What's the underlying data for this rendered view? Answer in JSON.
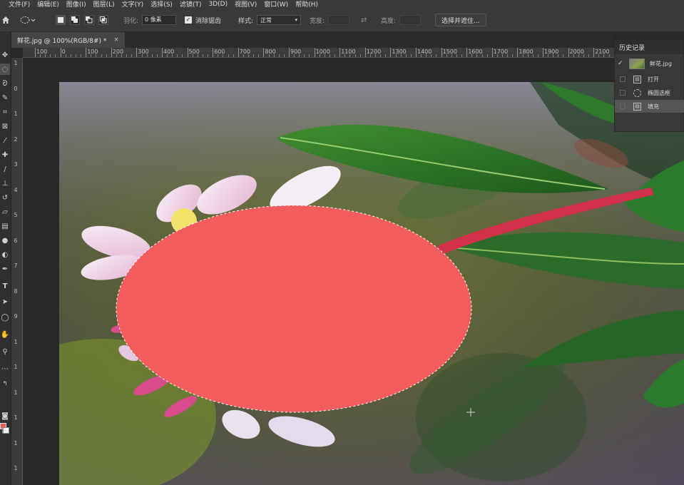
{
  "menu": [
    "文件(F)",
    "编辑(E)",
    "图像(I)",
    "图层(L)",
    "文字(Y)",
    "选择(S)",
    "滤镜(T)",
    "3D(D)",
    "视图(V)",
    "窗口(W)",
    "帮助(H)"
  ],
  "options": {
    "feather_label": "羽化:",
    "feather_value": "0 像素",
    "antialias_label": "消除锯齿",
    "antialias_checked": true,
    "style_label": "样式:",
    "style_value": "正常",
    "width_label": "宽度:",
    "height_label": "高度:",
    "select_mask_button": "选择并遮住..."
  },
  "document_tab": {
    "title": "鲜花.jpg @ 100%(RGB/8#) *",
    "close": "×"
  },
  "ruler_h_labels": [
    "100",
    "0",
    "100",
    "200",
    "300",
    "400",
    "500",
    "600",
    "700",
    "800",
    "900",
    "1000",
    "1100",
    "1200",
    "1300",
    "1400",
    "1500",
    "1600",
    "1700",
    "1800",
    "1900",
    "2000",
    "2100"
  ],
  "ruler_v_labels": [
    "1",
    "0",
    "1",
    "2",
    "3",
    "4",
    "5",
    "6",
    "7",
    "8",
    "9",
    "1",
    "1",
    "1",
    "1",
    "1",
    "1"
  ],
  "history": {
    "title": "历史记录",
    "snapshot": "鲜花.jpg",
    "steps": [
      "打开",
      "椭圆选框",
      "填充"
    ],
    "selected_step": "填充"
  },
  "colors": {
    "fill": "#f25c5c",
    "foreground": "#f25c5c",
    "background": "#ffffff"
  },
  "tools": [
    "move-icon",
    "elliptical-marquee-icon",
    "lasso-icon",
    "quick-select-icon",
    "crop-icon",
    "frame-icon",
    "eyedropper-icon",
    "healing-brush-icon",
    "brush-icon",
    "clone-stamp-icon",
    "history-brush-icon",
    "eraser-icon",
    "gradient-icon",
    "blur-icon",
    "dodge-icon",
    "pen-icon",
    "type-icon",
    "path-select-icon",
    "shape-icon",
    "hand-icon",
    "zoom-icon",
    "more-icon"
  ]
}
